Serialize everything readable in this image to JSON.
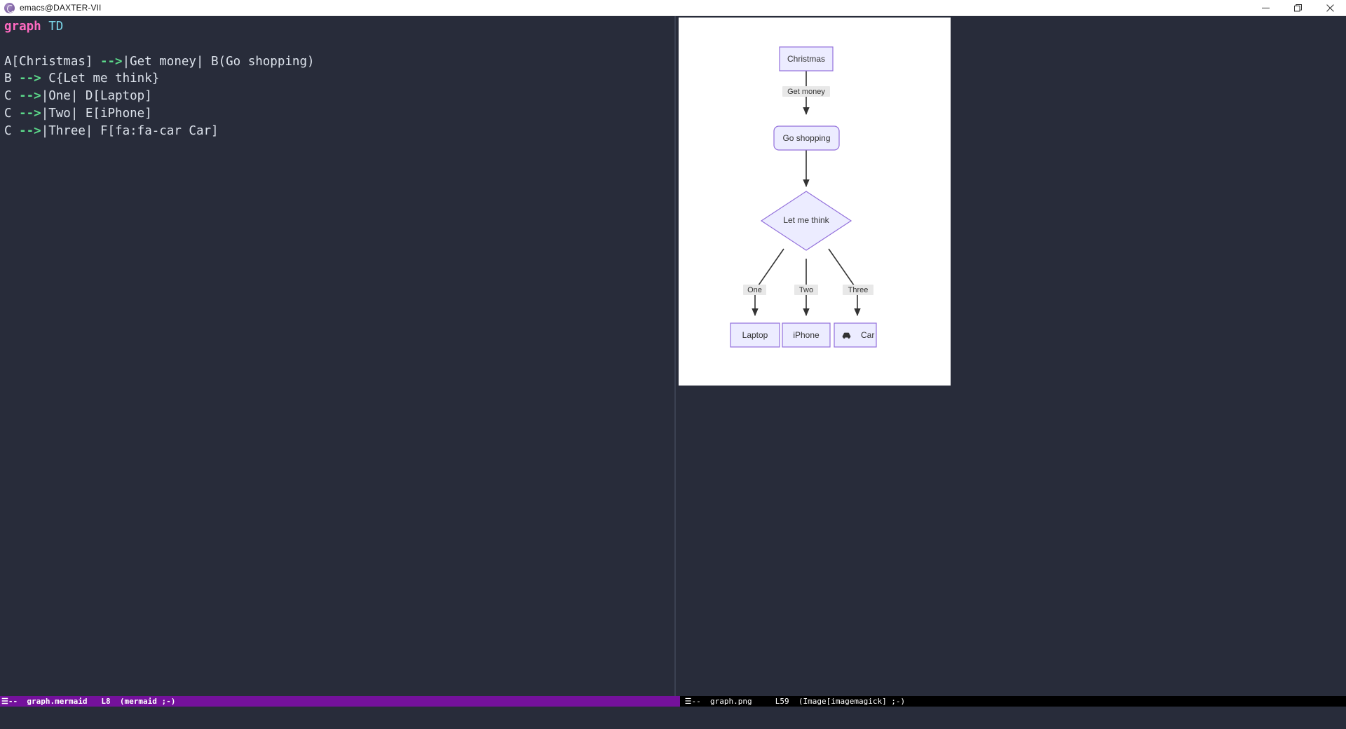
{
  "window": {
    "title": "emacs@DAXTER-VII",
    "app_icon": "emacs-logo-icon",
    "controls": {
      "minimize": "minimize-icon",
      "restore": "restore-icon",
      "close": "close-icon"
    }
  },
  "editor": {
    "buffer_name": "graph.mermaid",
    "code_lines": [
      {
        "tokens": [
          {
            "t": "graph",
            "c": "kw"
          },
          {
            "t": " ",
            "c": "txt"
          },
          {
            "t": "TD",
            "c": "typ"
          }
        ]
      },
      {
        "tokens": [
          {
            "t": "",
            "c": "txt"
          }
        ]
      },
      {
        "tokens": [
          {
            "t": "A[Christmas] ",
            "c": "txt"
          },
          {
            "t": "-->",
            "c": "arrow"
          },
          {
            "t": "|Get money| B(Go shopping)",
            "c": "txt"
          }
        ]
      },
      {
        "tokens": [
          {
            "t": "B ",
            "c": "txt"
          },
          {
            "t": "-->",
            "c": "arrow"
          },
          {
            "t": " C{Let me think}",
            "c": "txt"
          }
        ]
      },
      {
        "tokens": [
          {
            "t": "C ",
            "c": "txt"
          },
          {
            "t": "-->",
            "c": "arrow"
          },
          {
            "t": "|One| D[Laptop]",
            "c": "txt"
          }
        ]
      },
      {
        "tokens": [
          {
            "t": "C ",
            "c": "txt"
          },
          {
            "t": "-->",
            "c": "arrow"
          },
          {
            "t": "|Two| E[iPhone]",
            "c": "txt"
          }
        ]
      },
      {
        "tokens": [
          {
            "t": "C ",
            "c": "txt"
          },
          {
            "t": "-->",
            "c": "arrow"
          },
          {
            "t": "|Three| F[fa:fa-car Car]",
            "c": "txt"
          }
        ]
      }
    ],
    "plain_text": "graph TD\n\nA[Christmas] -->|Get money| B(Go shopping)\nB --> C{Let me think}\nC -->|One| D[Laptop]\nC -->|Two| E[iPhone]\nC -->|Three| F[fa:fa-car Car]"
  },
  "modeline_left": {
    "menu_glyph": "☰",
    "modified_flag": "--",
    "buffer": "graph.mermaid",
    "line": "L8",
    "major_mode": "(mermaid ;-)",
    "background": "#74119c"
  },
  "modeline_right": {
    "menu_glyph": "☰",
    "modified_flag": "--",
    "buffer": "graph.png",
    "line": "L59",
    "major_mode": "(Image[imagemagick] ;-)",
    "background": "#000000"
  },
  "diagram": {
    "direction": "TD",
    "canvas_background": "#ffffff",
    "node_fill": "#ececff",
    "node_stroke": "#9370db",
    "edge_stroke": "#333333",
    "edge_label_background": "#e8e8e8",
    "nodes": [
      {
        "id": "A",
        "label": "Christmas",
        "shape": "rect"
      },
      {
        "id": "B",
        "label": "Go shopping",
        "shape": "round"
      },
      {
        "id": "C",
        "label": "Let me think",
        "shape": "diamond"
      },
      {
        "id": "D",
        "label": "Laptop",
        "shape": "rect"
      },
      {
        "id": "E",
        "label": "iPhone",
        "shape": "rect"
      },
      {
        "id": "F",
        "label": "Car",
        "shape": "rect",
        "icon": "car-icon"
      }
    ],
    "edges": [
      {
        "from": "A",
        "to": "B",
        "label": "Get money"
      },
      {
        "from": "B",
        "to": "C",
        "label": ""
      },
      {
        "from": "C",
        "to": "D",
        "label": "One"
      },
      {
        "from": "C",
        "to": "E",
        "label": "Two"
      },
      {
        "from": "C",
        "to": "F",
        "label": "Three"
      }
    ]
  }
}
